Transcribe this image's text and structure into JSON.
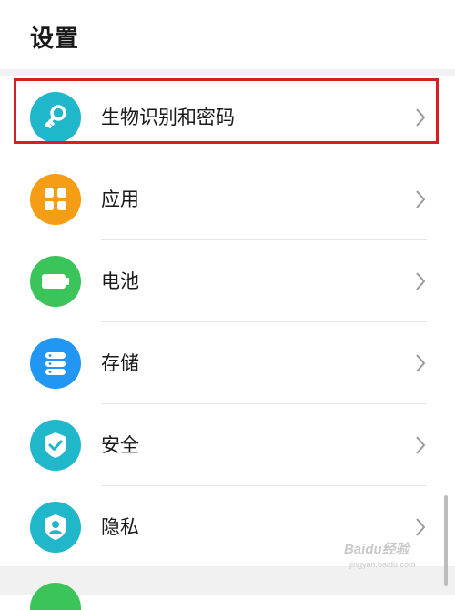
{
  "header": {
    "title": "设置"
  },
  "items": [
    {
      "label": "生物识别和密码",
      "icon": "key-icon",
      "color": "#1fb7c9"
    },
    {
      "label": "应用",
      "icon": "apps-grid-icon",
      "color": "#f59d14"
    },
    {
      "label": "电池",
      "icon": "battery-icon",
      "color": "#3ac45a"
    },
    {
      "label": "存储",
      "icon": "storage-icon",
      "color": "#2196f3"
    },
    {
      "label": "安全",
      "icon": "shield-check-icon",
      "color": "#1fb7c9"
    },
    {
      "label": "隐私",
      "icon": "privacy-shield-icon",
      "color": "#1fb7c9"
    }
  ],
  "highlight_color": "#d81e25",
  "watermark": {
    "text": "Baidu经验",
    "sub": "jingyan.baidu.com"
  }
}
